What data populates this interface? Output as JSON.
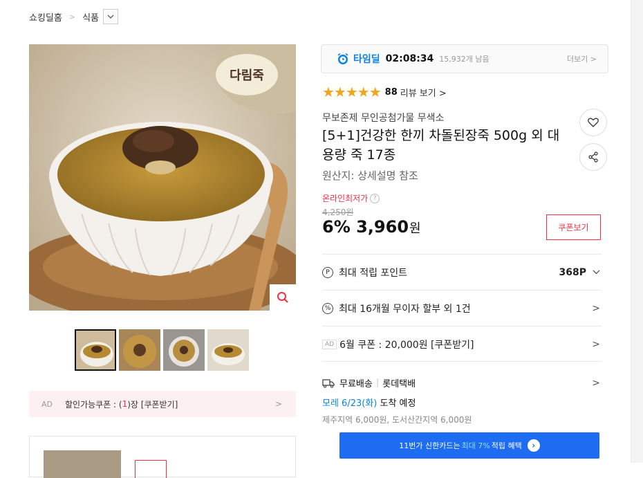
{
  "breadcrumb": {
    "home": "쇼킹딜홈",
    "category": "식품"
  },
  "brand_logo_text": "다림죽",
  "thumbnails_count": 4,
  "coupon_bar": {
    "ad": "AD",
    "prefix": "할인가능쿠폰 : (",
    "count": "1",
    "suffix": ")장 [쿠폰받기]"
  },
  "timedeal": {
    "title": "타임딜",
    "time": "02:08:34",
    "remaining": "15,932개 남음",
    "more": "더보기 >"
  },
  "rating": {
    "stars": 4.5,
    "stars_text": "★★★★★",
    "count": "88",
    "review": "리뷰 보기 >"
  },
  "product": {
    "seller": "무보존제 무인공첨가물 무색소",
    "title": "[5+1]건강한 한끼 차돌된장죽 500g 외 대용량 죽 17종",
    "origin": "원산지: 상세설명 참조"
  },
  "price": {
    "lowest_label": "온라인최저가",
    "original": "4,250원",
    "discount": "6%",
    "amount": "3,960",
    "unit": "원",
    "coupon_button": "쿠폰보기"
  },
  "benefits": {
    "points_label": "최대 적립 포인트",
    "points_value": "368P",
    "installment": "최대 16개월 무이자 할부 외 1건",
    "coupon_ad": "AD",
    "coupon": "6월 쿠폰 : 20,000원 [쿠폰받기]"
  },
  "shipping": {
    "free": "무료배송",
    "carrier": "롯데택배",
    "arrival_date": "모레 6/23(화)",
    "arrival_suffix": " 도착 예정",
    "extra": "제주지역 6,000원, 도서산간지역 6,000원"
  },
  "card_banner": {
    "prefix": "11번가 신한카드는",
    "highlight": "최대 7%",
    "suffix": "적립 혜택"
  },
  "colors": {
    "accent_red": "#f43142",
    "blue": "#0b83e6",
    "star": "#f0a51d",
    "button_blue": "#1d6cf2"
  }
}
